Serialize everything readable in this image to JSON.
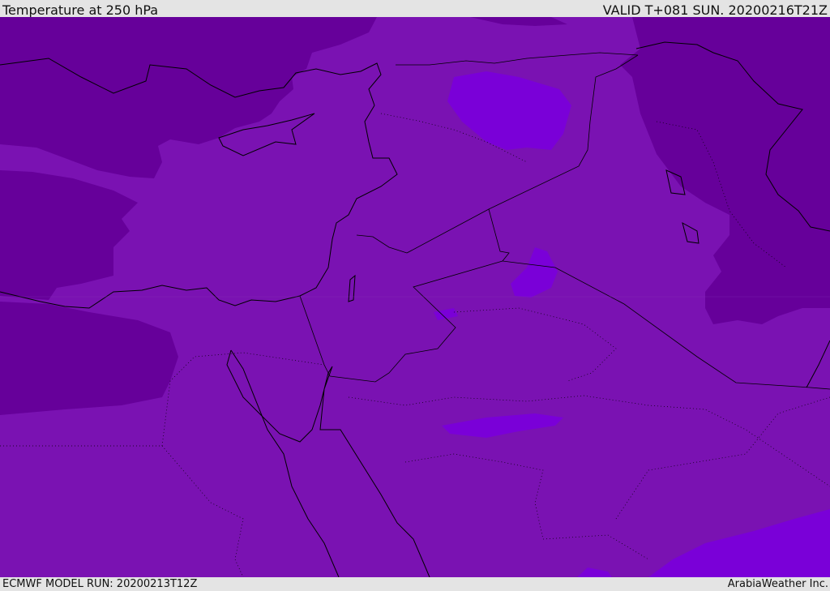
{
  "header": {
    "title": "Temperature at 250 hPa",
    "valid": "VALID T+081 SUN. 20200216T21Z"
  },
  "footer": {
    "model_run": "ECMWF MODEL RUN: 20200213T12Z",
    "credit": "ArabiaWeather Inc."
  },
  "colors": {
    "base": "#7a12b2",
    "cold": "#66009a",
    "warm": "#7a00d8",
    "coast": "#000000",
    "chrome": "#e4e4e4"
  }
}
